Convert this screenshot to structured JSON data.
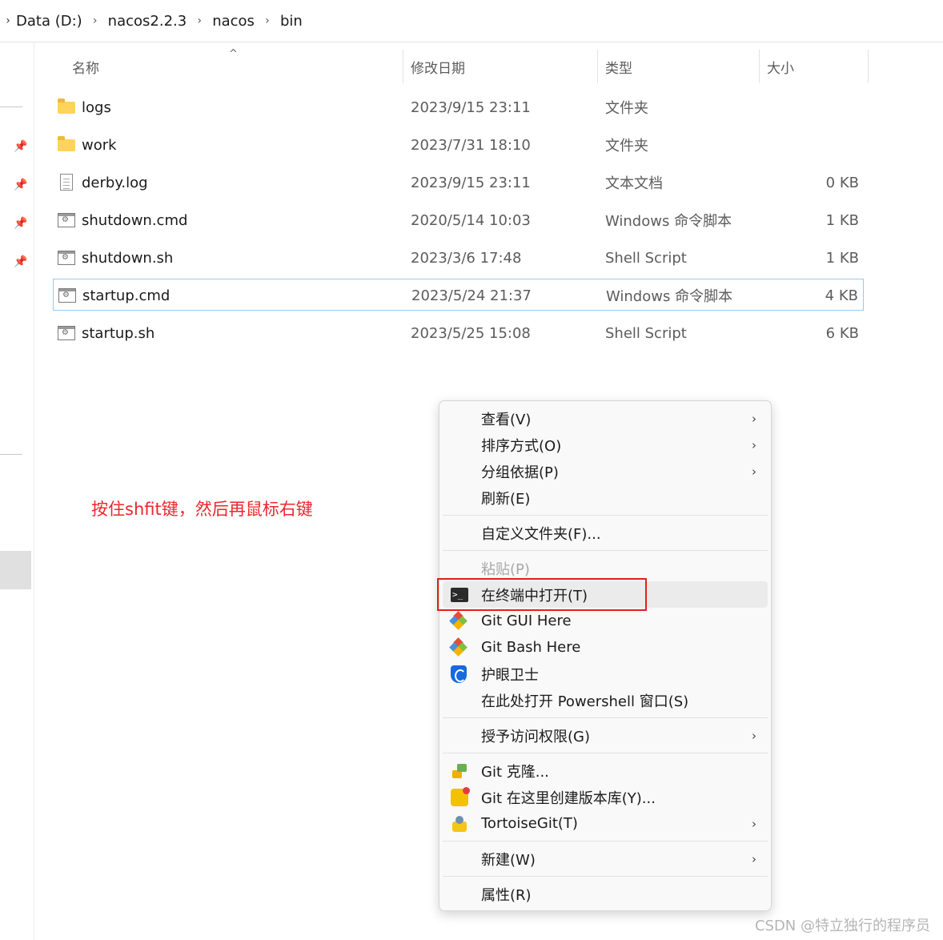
{
  "breadcrumb": {
    "items": [
      "Data (D:)",
      "nacos2.2.3",
      "nacos",
      "bin"
    ]
  },
  "columns": {
    "name": "名称",
    "date": "修改日期",
    "type": "类型",
    "size": "大小"
  },
  "files": [
    {
      "name": "logs",
      "date": "2023/9/15 23:11",
      "type": "文件夹",
      "size": "",
      "icon": "folder-icon"
    },
    {
      "name": "work",
      "date": "2023/7/31 18:10",
      "type": "文件夹",
      "size": "",
      "icon": "folder-icon"
    },
    {
      "name": "derby.log",
      "date": "2023/9/15 23:11",
      "type": "文本文档",
      "size": "0 KB",
      "icon": "text-file-icon"
    },
    {
      "name": "shutdown.cmd",
      "date": "2020/5/14 10:03",
      "type": "Windows 命令脚本",
      "size": "1 KB",
      "icon": "script-file-icon"
    },
    {
      "name": "shutdown.sh",
      "date": "2023/3/6 17:48",
      "type": "Shell Script",
      "size": "1 KB",
      "icon": "script-file-icon"
    },
    {
      "name": "startup.cmd",
      "date": "2023/5/24 21:37",
      "type": "Windows 命令脚本",
      "size": "4 KB",
      "icon": "script-file-icon"
    },
    {
      "name": "startup.sh",
      "date": "2023/5/25 15:08",
      "type": "Shell Script",
      "size": "6 KB",
      "icon": "script-file-icon"
    }
  ],
  "annotation": "按住shfit键，然后再鼠标右键",
  "context_menu": {
    "view": "查看(V)",
    "sort": "排序方式(O)",
    "group": "分组依据(P)",
    "refresh": "刷新(E)",
    "customize": "自定义文件夹(F)...",
    "paste": "粘贴(P)",
    "open_terminal": "在终端中打开(T)",
    "git_gui": "Git GUI Here",
    "git_bash": "Git Bash Here",
    "eye_guard": "护眼卫士",
    "powershell": "在此处打开 Powershell 窗口(S)",
    "grant_access": "授予访问权限(G)",
    "git_clone": "Git 克隆...",
    "git_create_repo": "Git 在这里创建版本库(Y)...",
    "tortoisegit": "TortoiseGit(T)",
    "new": "新建(W)",
    "properties": "属性(R)"
  },
  "watermark": "CSDN @特立独行的程序员",
  "colors": {
    "annotation": "#e8282b",
    "highlight_box": "#e02020",
    "selection_border": "#99c9ef"
  }
}
